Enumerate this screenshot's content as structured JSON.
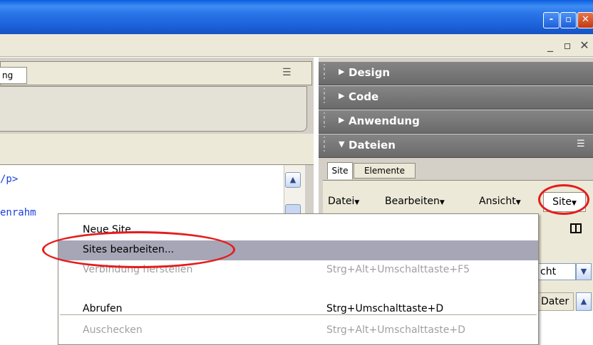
{
  "window": {
    "controls": [
      "-",
      "▫",
      "✕"
    ]
  },
  "left_panel": {
    "tab_label": "ng",
    "options_glyph": "☰",
    "code_lines": [
      "/p>",
      "enrahm"
    ]
  },
  "right_panel": {
    "sections": [
      {
        "label": "Design",
        "state": "collapsed"
      },
      {
        "label": "Code",
        "state": "collapsed"
      },
      {
        "label": "Anwendung",
        "state": "collapsed"
      },
      {
        "label": "Dateien",
        "state": "expanded"
      }
    ],
    "tabs": [
      "Site",
      "Elemente"
    ],
    "file_menus": [
      "Datei",
      "Bearbeiten",
      "Ansicht",
      "Site"
    ],
    "view_select_value": "cht",
    "column_header": "Dater"
  },
  "dropdown": {
    "items": [
      {
        "label": "Neue Site ...",
        "shortcut": "",
        "state": "enabled"
      },
      {
        "label": "Sites bearbeiten...",
        "shortcut": "",
        "state": "highlighted"
      },
      {
        "label": "Verbindung herstellen",
        "shortcut": "Strg+Alt+Umschalttaste+F5",
        "state": "disabled"
      },
      {
        "label": "Abrufen",
        "shortcut": "Strg+Umschalttaste+D",
        "state": "enabled"
      },
      {
        "label": "Auschecken",
        "shortcut": "Strg+Alt+Umschalttaste+D",
        "state": "disabled"
      }
    ]
  },
  "colors": {
    "titlebar": "#2a74e8",
    "panel_header": "#777777",
    "menu_highlight": "#a6a6b6",
    "annotation": "#e41d1d"
  }
}
